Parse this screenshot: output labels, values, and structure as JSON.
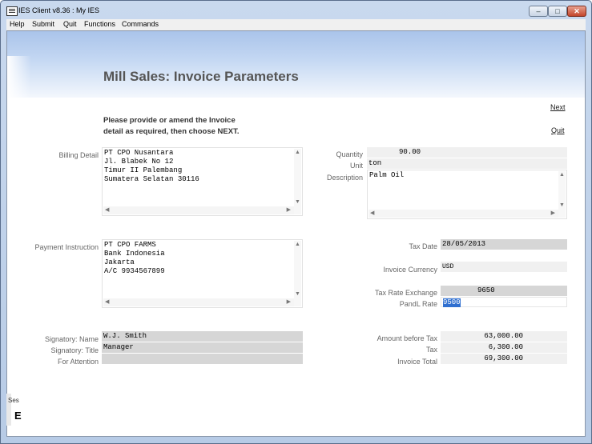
{
  "window": {
    "title": "IES Client v8.36 : My IES"
  },
  "menu": [
    "Help",
    "Submit",
    "Quit",
    "Functions",
    "Commands"
  ],
  "page": {
    "title": "Mill Sales: Invoice Parameters",
    "instruction_line1": "Please provide or amend the Invoice",
    "instruction_line2": "detail as required, then choose NEXT.",
    "next_link": "Next",
    "quit_link": "Quit"
  },
  "labels": {
    "billing_detail": "Billing Detail",
    "payment_instruction": "Payment Instruction",
    "signatory_name": "Signatory: Name",
    "signatory_title": "Signatory: Title",
    "for_attention": "For Attention",
    "quantity": "Quantity",
    "unit": "Unit",
    "description": "Description",
    "tax_date": "Tax Date",
    "invoice_currency": "Invoice Currency",
    "tax_rate_exchange": "Tax Rate Exchange",
    "pandl_rate": "PandL Rate",
    "amount_before_tax": "Amount before Tax",
    "tax": "Tax",
    "invoice_total": "Invoice Total"
  },
  "values": {
    "billing_detail": "PT CPO Nusantara\nJl. Blabek No 12\nTimur II Palembang\nSumatera Selatan 30116",
    "payment_instruction": "PT CPO FARMS\nBank Indonesia\nJakarta\nA/C 9934567899",
    "signatory_name": "W.J. Smith",
    "signatory_title": "Manager",
    "for_attention": "",
    "quantity": "90.00",
    "unit": "ton",
    "description": "Palm Oil",
    "tax_date": "28/05/2013",
    "invoice_currency": "USD",
    "tax_rate_exchange": "9650",
    "pandl_rate": "9500",
    "amount_before_tax": "63,000.00",
    "tax": "6,300.00",
    "invoice_total": "69,300.00"
  },
  "side_panel": {
    "label": "Ses",
    "glyph": "E"
  }
}
